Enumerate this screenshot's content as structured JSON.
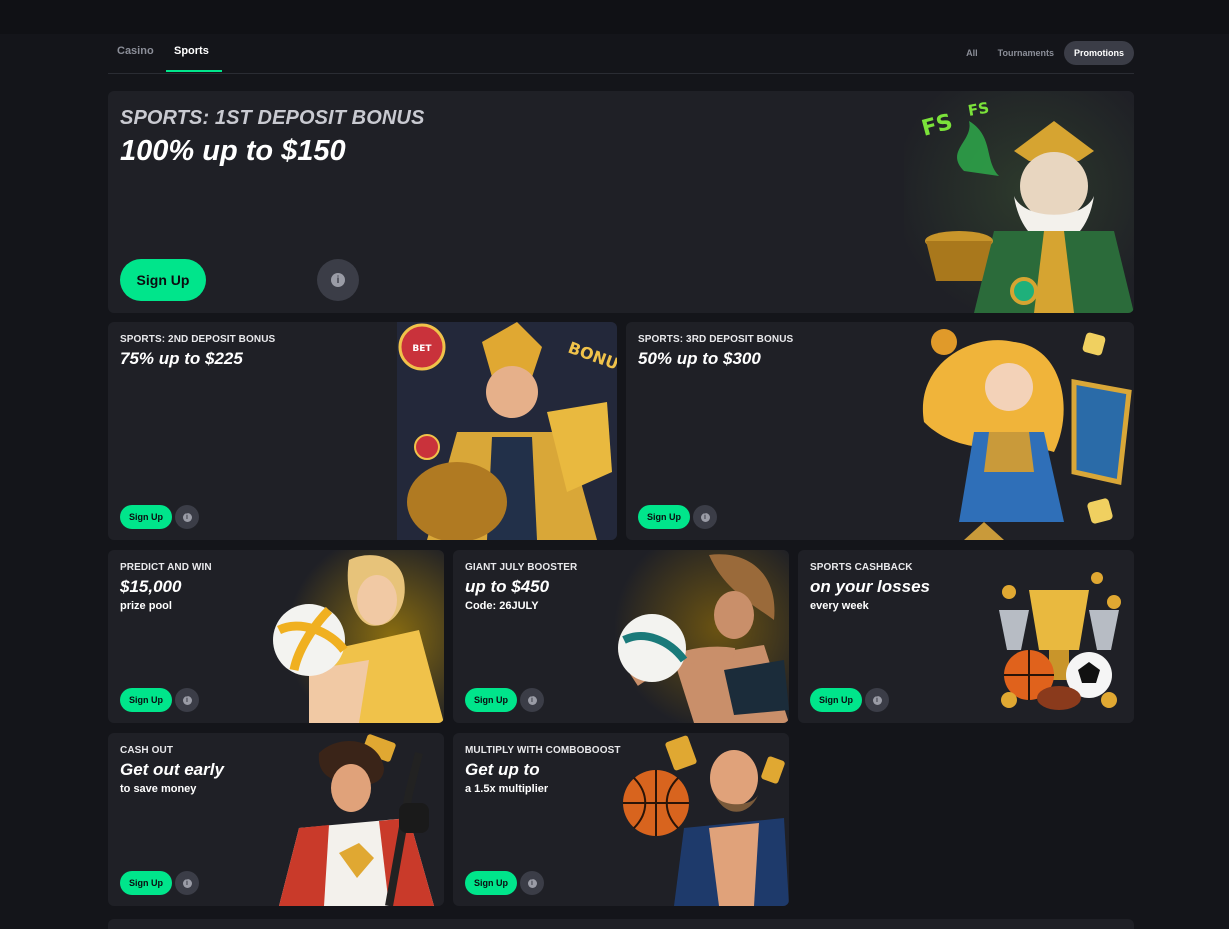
{
  "tabs": {
    "casino": "Casino",
    "sports": "Sports"
  },
  "filters": {
    "all": "All",
    "tournaments": "Tournaments",
    "promotions": "Promotions"
  },
  "colors": {
    "accent": "#00e58b",
    "card_bg": "#1f2026",
    "page_bg": "#14151a"
  },
  "promos": [
    {
      "eyebrow": "SPORTS: 1ST DEPOSIT BONUS",
      "headline": "100% up to $150",
      "sub": "",
      "button": "Sign Up",
      "info_icon": "info-icon"
    },
    {
      "eyebrow": "SPORTS: 2ND DEPOSIT BONUS",
      "headline": "75% up to $225",
      "sub": "",
      "button": "Sign Up",
      "info_icon": "info-icon"
    },
    {
      "eyebrow": "SPORTS: 3RD DEPOSIT BONUS",
      "headline": "50% up to $300",
      "sub": "",
      "button": "Sign Up",
      "info_icon": "info-icon"
    },
    {
      "eyebrow": "PREDICT AND WIN",
      "headline": "$15,000",
      "sub": "prize pool",
      "button": "Sign Up",
      "info_icon": "info-icon"
    },
    {
      "eyebrow": "GIANT JULY BOOSTER",
      "headline": "up to $450",
      "sub": "Code: 26JULY",
      "button": "Sign Up",
      "info_icon": "info-icon"
    },
    {
      "eyebrow": "SPORTS CASHBACK",
      "headline": "on your losses",
      "sub": "every week",
      "button": "Sign Up",
      "info_icon": "info-icon"
    },
    {
      "eyebrow": "CASH OUT",
      "headline": "Get out early",
      "sub": "to save money",
      "button": "Sign Up",
      "info_icon": "info-icon"
    },
    {
      "eyebrow": "MULTIPLY WITH COMBOBOOST",
      "headline": "Get up to",
      "sub": "a 1.5x multiplier",
      "button": "Sign Up",
      "info_icon": "info-icon"
    }
  ]
}
